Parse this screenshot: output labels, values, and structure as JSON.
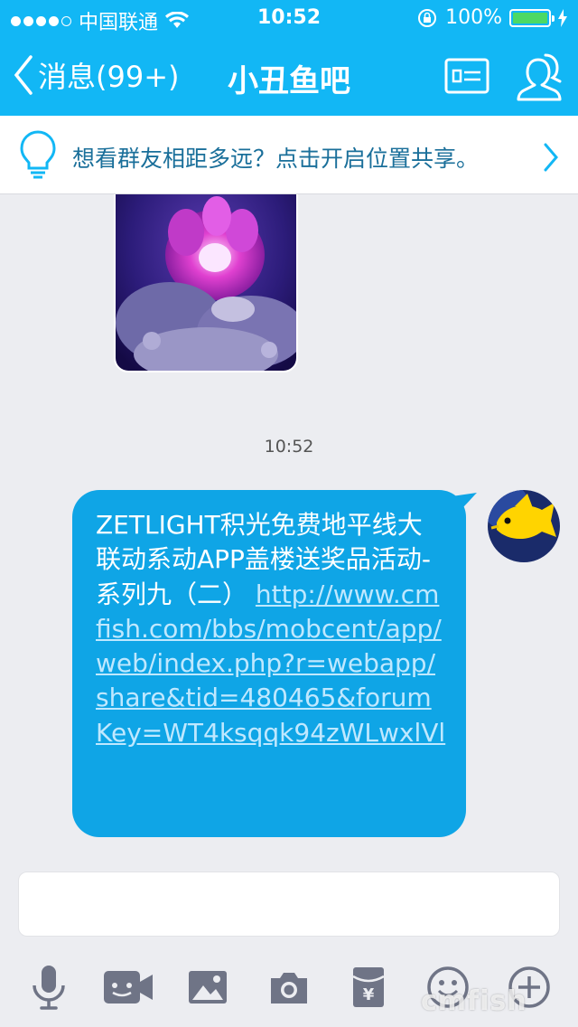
{
  "status_bar": {
    "carrier": "中国联通",
    "time": "10:52",
    "battery": "100%"
  },
  "nav": {
    "back_label": "消息(99+)",
    "title": "小丑鱼吧"
  },
  "tip": {
    "text": "想看群友相距多远？点击开启位置共享。"
  },
  "chat": {
    "timestamp": "10:52",
    "message": {
      "text": "ZETLIGHT积光免费地平线大联动系动APP盖楼送奖品活动-系列九（二）",
      "link": "http://www.cmfish.com/bbs/mobcent/app/web/index.php?r=webapp/share&tid=480465&forumKey=WT4ksqqk94zWLwxlVl"
    }
  },
  "watermark": "cmfish",
  "colors": {
    "nav_bg": "#12b7f5",
    "bubble_bg": "#0fa5e6",
    "page_bg": "#ecedf1",
    "tool_icon": "#6f7486"
  },
  "icons": {
    "toolbar": [
      "microphone-icon",
      "video-icon",
      "image-icon",
      "camera-icon",
      "red-packet-icon",
      "emoji-icon",
      "plus-icon"
    ]
  }
}
